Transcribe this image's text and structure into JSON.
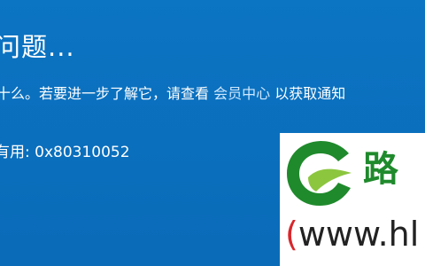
{
  "error_screen": {
    "title": "问题...",
    "info_before": "十么。若要进一步了解它，请查看",
    "info_link": "会员中心",
    "info_after": "以获取通知",
    "code_line": "有用: 0x80310052"
  },
  "watermark": {
    "brand_text": "路",
    "domain_paren": "(",
    "domain_text": "www.hl",
    "logo_icon": "leaf-swoosh-logo",
    "colors": {
      "green": "#1f8a2c",
      "light_green": "#8cc63f",
      "red": "#d8262b"
    }
  },
  "colors": {
    "background": "#0a6fbf",
    "text": "#ffffff",
    "link": "#cfe8ff"
  }
}
